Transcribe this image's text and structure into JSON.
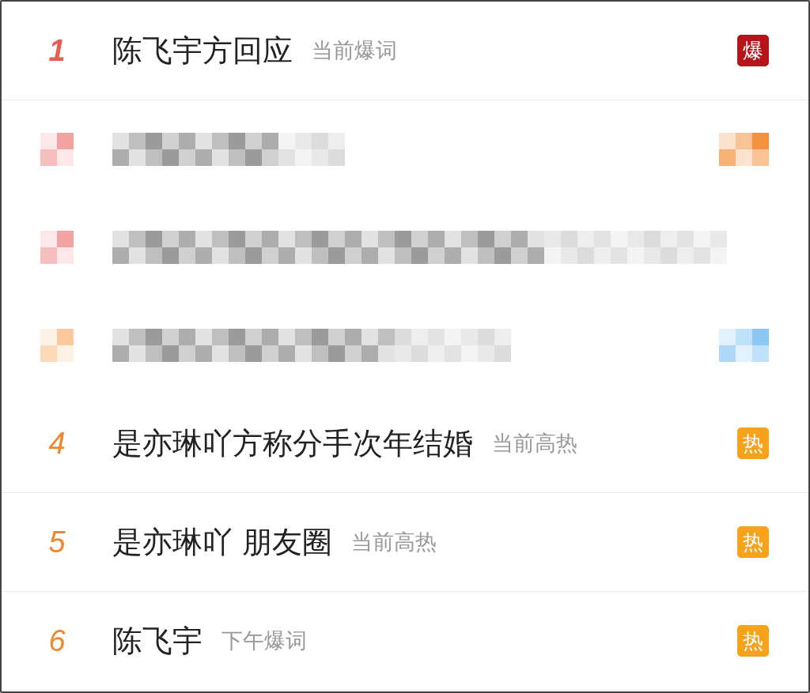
{
  "hot_list": [
    {
      "kind": "topic",
      "rank": {
        "text": "1",
        "color": "#ec5b4f"
      },
      "title": "陈飞宇方回应",
      "tag": "当前爆词",
      "badge": {
        "text": "爆",
        "color": "#b5141b"
      }
    },
    {
      "kind": "redacted",
      "rank": {
        "color": "#f4a3a3"
      },
      "badge": {
        "color": "#f4913f"
      }
    },
    {
      "kind": "redacted",
      "rank": {
        "color": "#f4a3a3"
      }
    },
    {
      "kind": "redacted",
      "rank": {
        "color": "#fbc99a"
      },
      "badge": {
        "color": "#8cc8f5"
      }
    },
    {
      "kind": "topic",
      "rank": {
        "text": "4",
        "color": "#f0862e"
      },
      "title": "是亦琳吖方称分手次年结婚",
      "tag": "当前高热",
      "badge": {
        "text": "热",
        "color": "#f7a21b"
      }
    },
    {
      "kind": "topic",
      "rank": {
        "text": "5",
        "color": "#f0862e"
      },
      "title": "是亦琳吖 朋友圈",
      "tag": "当前高热",
      "badge": {
        "text": "热",
        "color": "#f7a21b"
      }
    },
    {
      "kind": "topic",
      "rank": {
        "text": "6",
        "color": "#f0862e"
      },
      "title": "陈飞宇",
      "tag": "下午爆词",
      "badge": {
        "text": "热",
        "color": "#f7a21b"
      }
    }
  ]
}
